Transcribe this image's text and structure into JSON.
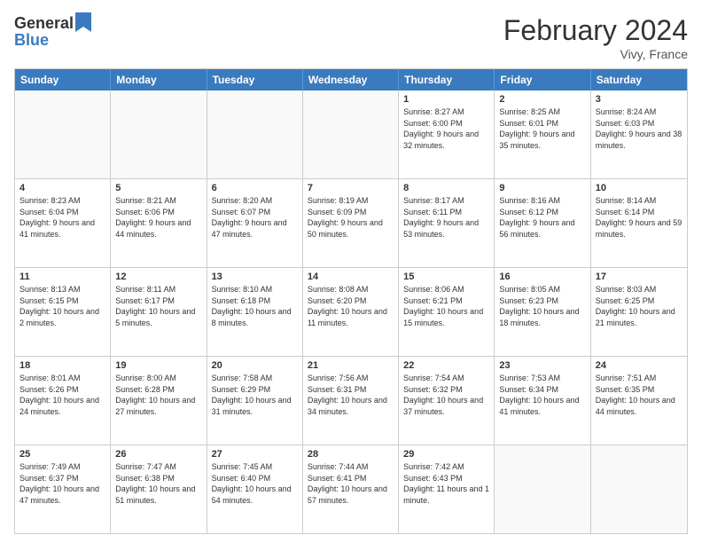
{
  "logo": {
    "general": "General",
    "blue": "Blue"
  },
  "title": {
    "month_year": "February 2024",
    "location": "Vivy, France"
  },
  "header_days": [
    "Sunday",
    "Monday",
    "Tuesday",
    "Wednesday",
    "Thursday",
    "Friday",
    "Saturday"
  ],
  "weeks": [
    [
      {
        "day": "",
        "info": ""
      },
      {
        "day": "",
        "info": ""
      },
      {
        "day": "",
        "info": ""
      },
      {
        "day": "",
        "info": ""
      },
      {
        "day": "1",
        "info": "Sunrise: 8:27 AM\nSunset: 6:00 PM\nDaylight: 9 hours and 32 minutes."
      },
      {
        "day": "2",
        "info": "Sunrise: 8:25 AM\nSunset: 6:01 PM\nDaylight: 9 hours and 35 minutes."
      },
      {
        "day": "3",
        "info": "Sunrise: 8:24 AM\nSunset: 6:03 PM\nDaylight: 9 hours and 38 minutes."
      }
    ],
    [
      {
        "day": "4",
        "info": "Sunrise: 8:23 AM\nSunset: 6:04 PM\nDaylight: 9 hours and 41 minutes."
      },
      {
        "day": "5",
        "info": "Sunrise: 8:21 AM\nSunset: 6:06 PM\nDaylight: 9 hours and 44 minutes."
      },
      {
        "day": "6",
        "info": "Sunrise: 8:20 AM\nSunset: 6:07 PM\nDaylight: 9 hours and 47 minutes."
      },
      {
        "day": "7",
        "info": "Sunrise: 8:19 AM\nSunset: 6:09 PM\nDaylight: 9 hours and 50 minutes."
      },
      {
        "day": "8",
        "info": "Sunrise: 8:17 AM\nSunset: 6:11 PM\nDaylight: 9 hours and 53 minutes."
      },
      {
        "day": "9",
        "info": "Sunrise: 8:16 AM\nSunset: 6:12 PM\nDaylight: 9 hours and 56 minutes."
      },
      {
        "day": "10",
        "info": "Sunrise: 8:14 AM\nSunset: 6:14 PM\nDaylight: 9 hours and 59 minutes."
      }
    ],
    [
      {
        "day": "11",
        "info": "Sunrise: 8:13 AM\nSunset: 6:15 PM\nDaylight: 10 hours and 2 minutes."
      },
      {
        "day": "12",
        "info": "Sunrise: 8:11 AM\nSunset: 6:17 PM\nDaylight: 10 hours and 5 minutes."
      },
      {
        "day": "13",
        "info": "Sunrise: 8:10 AM\nSunset: 6:18 PM\nDaylight: 10 hours and 8 minutes."
      },
      {
        "day": "14",
        "info": "Sunrise: 8:08 AM\nSunset: 6:20 PM\nDaylight: 10 hours and 11 minutes."
      },
      {
        "day": "15",
        "info": "Sunrise: 8:06 AM\nSunset: 6:21 PM\nDaylight: 10 hours and 15 minutes."
      },
      {
        "day": "16",
        "info": "Sunrise: 8:05 AM\nSunset: 6:23 PM\nDaylight: 10 hours and 18 minutes."
      },
      {
        "day": "17",
        "info": "Sunrise: 8:03 AM\nSunset: 6:25 PM\nDaylight: 10 hours and 21 minutes."
      }
    ],
    [
      {
        "day": "18",
        "info": "Sunrise: 8:01 AM\nSunset: 6:26 PM\nDaylight: 10 hours and 24 minutes."
      },
      {
        "day": "19",
        "info": "Sunrise: 8:00 AM\nSunset: 6:28 PM\nDaylight: 10 hours and 27 minutes."
      },
      {
        "day": "20",
        "info": "Sunrise: 7:58 AM\nSunset: 6:29 PM\nDaylight: 10 hours and 31 minutes."
      },
      {
        "day": "21",
        "info": "Sunrise: 7:56 AM\nSunset: 6:31 PM\nDaylight: 10 hours and 34 minutes."
      },
      {
        "day": "22",
        "info": "Sunrise: 7:54 AM\nSunset: 6:32 PM\nDaylight: 10 hours and 37 minutes."
      },
      {
        "day": "23",
        "info": "Sunrise: 7:53 AM\nSunset: 6:34 PM\nDaylight: 10 hours and 41 minutes."
      },
      {
        "day": "24",
        "info": "Sunrise: 7:51 AM\nSunset: 6:35 PM\nDaylight: 10 hours and 44 minutes."
      }
    ],
    [
      {
        "day": "25",
        "info": "Sunrise: 7:49 AM\nSunset: 6:37 PM\nDaylight: 10 hours and 47 minutes."
      },
      {
        "day": "26",
        "info": "Sunrise: 7:47 AM\nSunset: 6:38 PM\nDaylight: 10 hours and 51 minutes."
      },
      {
        "day": "27",
        "info": "Sunrise: 7:45 AM\nSunset: 6:40 PM\nDaylight: 10 hours and 54 minutes."
      },
      {
        "day": "28",
        "info": "Sunrise: 7:44 AM\nSunset: 6:41 PM\nDaylight: 10 hours and 57 minutes."
      },
      {
        "day": "29",
        "info": "Sunrise: 7:42 AM\nSunset: 6:43 PM\nDaylight: 11 hours and 1 minute."
      },
      {
        "day": "",
        "info": ""
      },
      {
        "day": "",
        "info": ""
      }
    ]
  ]
}
